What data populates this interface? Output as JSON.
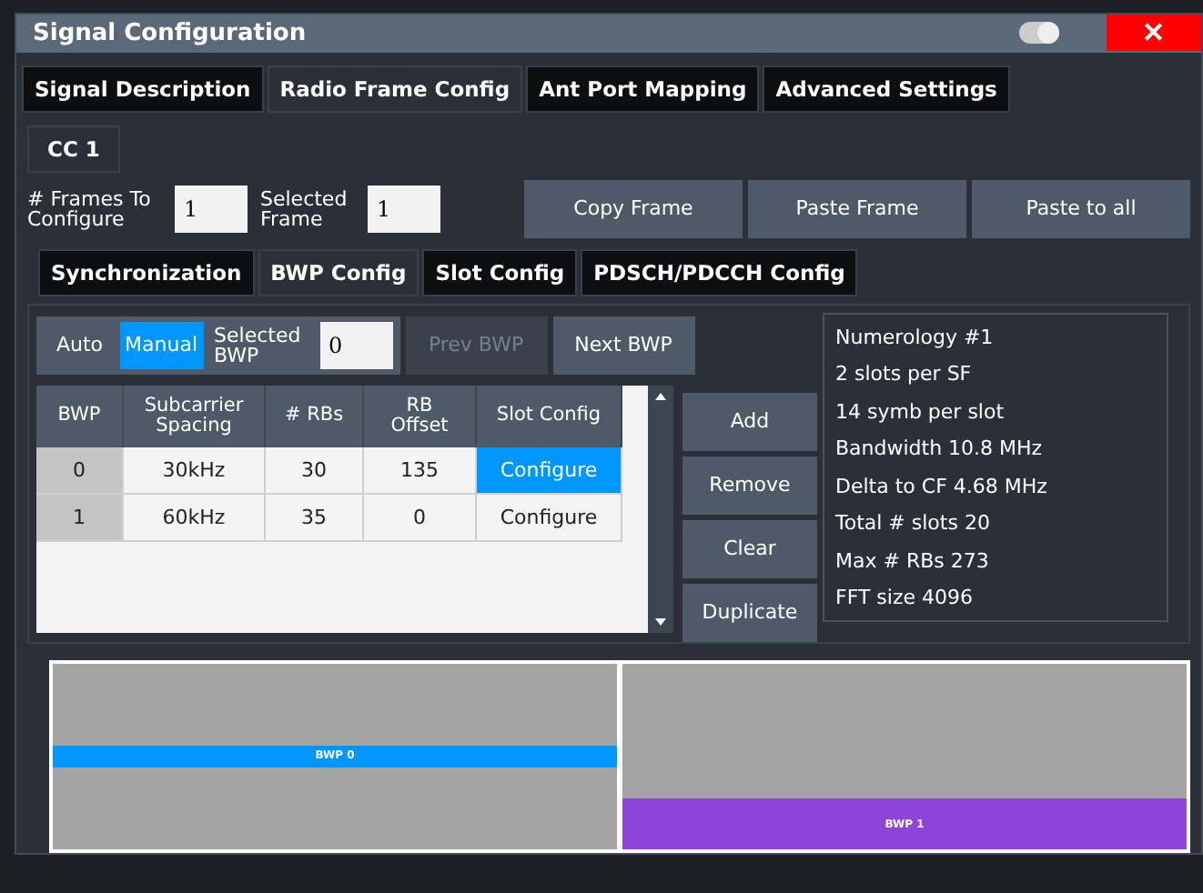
{
  "window": {
    "title": "Signal Configuration",
    "close": "✕",
    "toggle_on": true
  },
  "tabs": [
    {
      "label": "Signal Description",
      "selected": false
    },
    {
      "label": "Radio Frame Config",
      "selected": true
    },
    {
      "label": "Ant Port Mapping",
      "selected": false
    },
    {
      "label": "Advanced Settings",
      "selected": false
    }
  ],
  "carrier_tabs": [
    {
      "label": "CC 1",
      "selected": true
    }
  ],
  "frames": {
    "count_label": "# Frames To Configure",
    "count": "1",
    "selected_label": "Selected Frame",
    "selected": "1",
    "buttons": [
      "Copy Frame",
      "Paste Frame",
      "Paste to all"
    ]
  },
  "sub_tabs": [
    {
      "label": "Synchronization",
      "selected": false
    },
    {
      "label": "BWP Config",
      "selected": true
    },
    {
      "label": "Slot Config",
      "selected": false
    },
    {
      "label": "PDSCH/PDCCH Config",
      "selected": false
    }
  ],
  "bwp_controls": {
    "modes": [
      {
        "label": "Auto",
        "selected": false
      },
      {
        "label": "Manual",
        "selected": true
      }
    ],
    "selected_label": "Selected BWP",
    "selected_value": "0",
    "prev": {
      "label": "Prev BWP",
      "disabled": true
    },
    "next": {
      "label": "Next BWP",
      "disabled": false
    }
  },
  "table": {
    "columns": [
      "BWP",
      "Subcarrier Spacing",
      "# RBs",
      "RB Offset",
      "Slot Config"
    ],
    "rows": [
      {
        "cells": [
          "0",
          "30kHz",
          "30",
          "135",
          "Configure"
        ],
        "selected": true
      },
      {
        "cells": [
          "1",
          "60kHz",
          "35",
          "0",
          "Configure"
        ],
        "selected": false
      }
    ]
  },
  "actions": [
    "Add",
    "Remove",
    "Clear",
    "Duplicate"
  ],
  "info": [
    "Numerology #1",
    "2 slots per SF",
    "14 symb per slot",
    "Bandwidth 10.8 MHz",
    "Delta to CF 4.68 MHz",
    "Total # slots 20",
    "Max # RBs 273",
    "FFT size 4096"
  ],
  "bwp_graph": [
    {
      "label": "BWP 0",
      "color": "#0096ff",
      "kind": "mid"
    },
    {
      "label": "BWP 1",
      "color": "#8e44d8",
      "kind": "low"
    }
  ]
}
